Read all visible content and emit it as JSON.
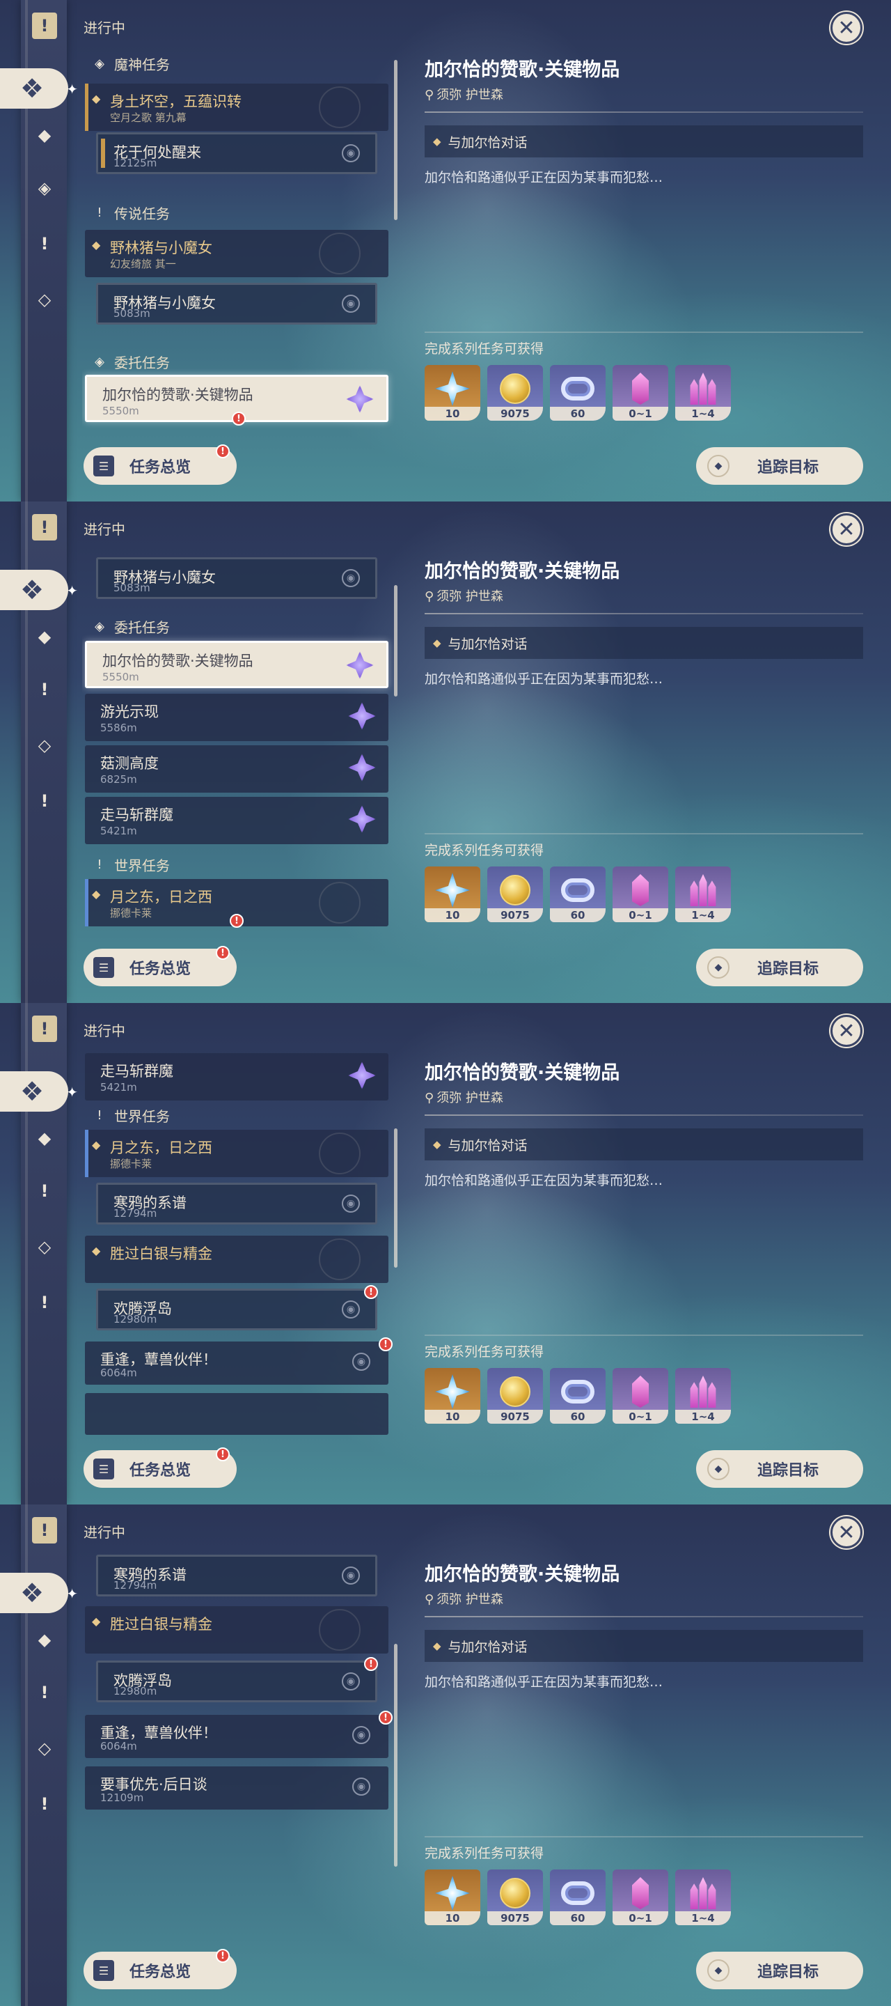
{
  "panels": [
    {
      "header": "进行中",
      "detail": {
        "title": "加尔恰的赞歌·关键物品",
        "location": "须弥 护世森",
        "objective": "与加尔恰对话",
        "description": "加尔恰和路通似乎正在因为某事而犯愁…",
        "rewards_title": "完成系列任务可获得",
        "rewards": [
          {
            "icon": "primogem-icon",
            "qty": "10"
          },
          {
            "icon": "mora-icon",
            "qty": "9075"
          },
          {
            "icon": "fate-ring-icon",
            "qty": "60"
          },
          {
            "icon": "crystal-icon",
            "qty": "0~1"
          },
          {
            "icon": "crystal-cluster-icon",
            "qty": "1~4"
          }
        ]
      },
      "buttons": {
        "summary": "任务总览",
        "track": "追踪目标"
      }
    }
  ],
  "list1": {
    "g_archon": "魔神任务",
    "q1_title": "身土坏空，五蕴识转",
    "q1_sub": "空月之歌 第九幕",
    "q1a_title": "花于何处醒来",
    "q1a_sub": "12125m",
    "g_legend": "传说任务",
    "q2_title": "野林猪与小魔女",
    "q2_sub": "幻友绮旅 其一",
    "q2a_title": "野林猪与小魔女",
    "q2a_sub": "5083m",
    "g_commission": "委托任务",
    "q3_title": "加尔恰的赞歌·关键物品",
    "q3_sub": "5550m"
  },
  "list2": {
    "q2a_title": "野林猪与小魔女",
    "q2a_sub": "5083m",
    "g_commission": "委托任务",
    "q3_title": "加尔恰的赞歌·关键物品",
    "q3_sub": "5550m",
    "q4_title": "游光示现",
    "q4_sub": "5586m",
    "q5_title": "菇测高度",
    "q5_sub": "6825m",
    "q6_title": "走马斩群魔",
    "q6_sub": "5421m",
    "g_world": "世界任务",
    "q7_title": "月之东，日之西",
    "q7_sub": "挪德卡莱"
  },
  "list3": {
    "q6_title": "走马斩群魔",
    "q6_sub": "5421m",
    "g_world": "世界任务",
    "q7_title": "月之东，日之西",
    "q7_sub": "挪德卡莱",
    "q7a_title": "寒鸦的系谱",
    "q7a_sub": "12794m",
    "q8_title": "胜过白银与精金",
    "q8a_title": "欢腾浮岛",
    "q8a_sub": "12980m",
    "q9_title": "重逢，蕈兽伙伴！",
    "q9_sub": "6064m"
  },
  "list4": {
    "q7a_title": "寒鸦的系谱",
    "q7a_sub": "12794m",
    "q8_title": "胜过白银与精金",
    "q8a_title": "欢腾浮岛",
    "q8a_sub": "12980m",
    "q9_title": "重逢，蕈兽伙伴！",
    "q9_sub": "6064m",
    "q10_title": "要事优先·后日谈",
    "q10_sub": "12109m"
  },
  "icons": {
    "close": "close-icon",
    "summary": "quest-book-icon",
    "track": "track-target-icon",
    "pin": "location-pin-icon"
  }
}
